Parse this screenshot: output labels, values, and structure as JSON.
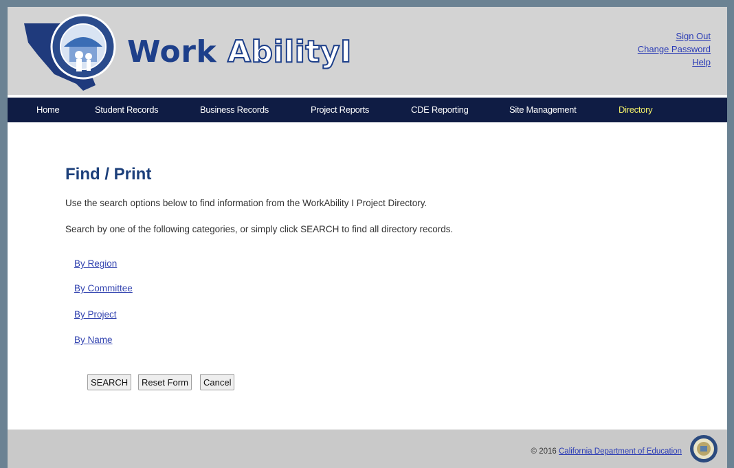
{
  "header": {
    "logo_word1": "Work",
    "logo_word2": "Ability",
    "logo_numeral": "I",
    "links": {
      "sign_out": "Sign Out",
      "change_password": "Change Password",
      "help": "Help"
    }
  },
  "nav": {
    "active": "Directory",
    "items": [
      "Home",
      "Student Records",
      "Business Records",
      "Project Reports",
      "CDE Reporting",
      "Site Management",
      "Directory"
    ]
  },
  "main": {
    "title": "Find / Print",
    "desc1": "Use the search options below to find information from the WorkAbility I Project Directory.",
    "desc2": "Search by one of the following categories, or simply click SEARCH to find all directory records.",
    "categories": [
      "By Region",
      "By Committee",
      "By Project",
      "By Name"
    ],
    "buttons": {
      "search": "SEARCH",
      "reset": "Reset Form",
      "cancel": "Cancel"
    }
  },
  "footer": {
    "copyright": "© 2016",
    "link": "California Department of Education"
  },
  "colors": {
    "nav_bg": "#0f1c44",
    "nav_active": "#f5f26a",
    "title": "#1c3f7a",
    "link": "#3344b0"
  }
}
